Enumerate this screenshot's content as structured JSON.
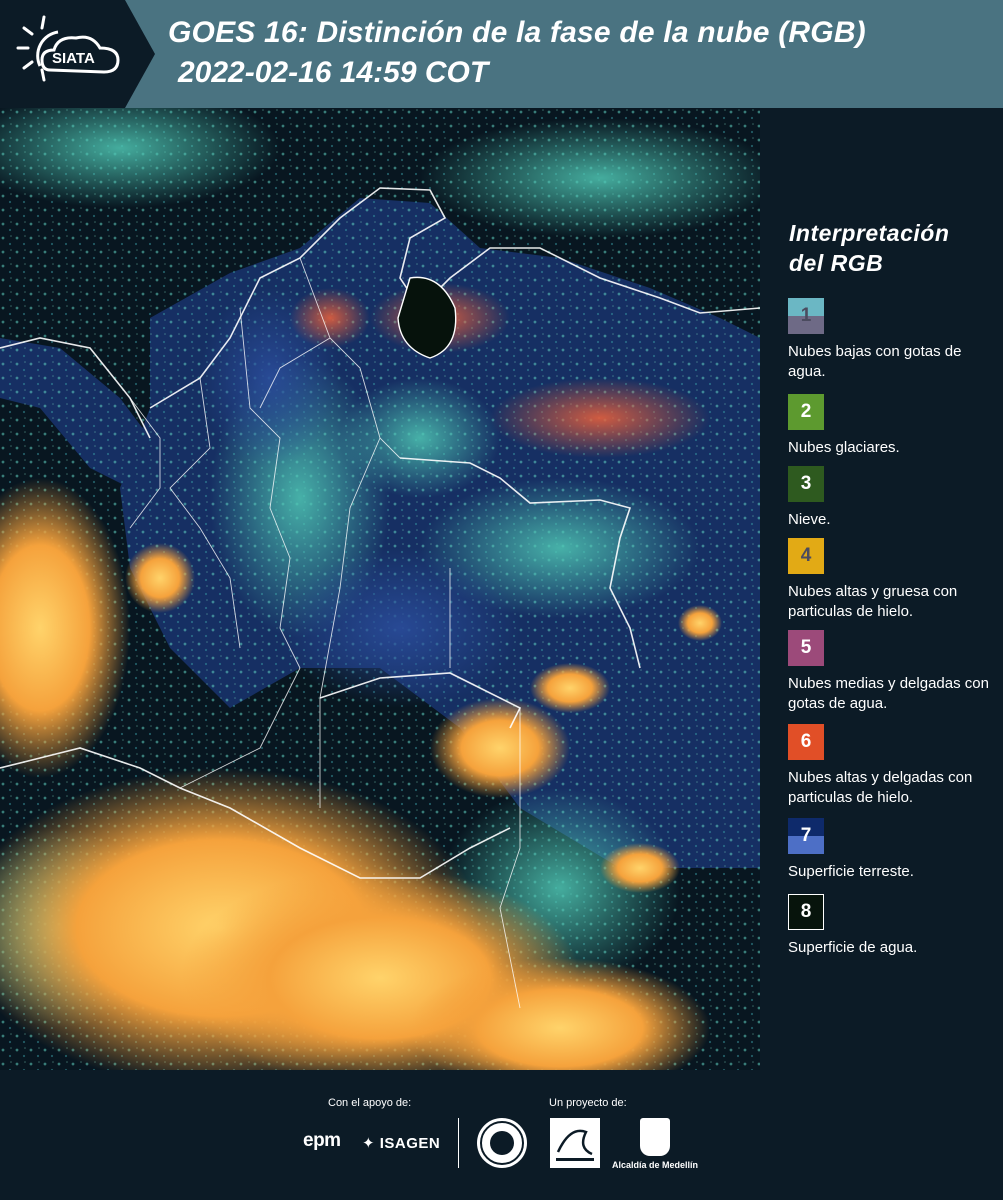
{
  "header": {
    "logo_text": "SIATA",
    "title_line1": "GOES 16: Distinción de la fase de la nube (RGB)",
    "title_line2": "2022-02-16 14:59 COT"
  },
  "legend": {
    "title_line1": "Interpretación",
    "title_line2": "del RGB",
    "items": [
      {
        "num": "1",
        "label": "Nubes bajas con gotas de agua.",
        "color_top": "#6bb7c4",
        "color_bottom": "#6e6a86",
        "num_color": "#4b4b5f"
      },
      {
        "num": "2",
        "label": "Nubes glaciares.",
        "color_top": "#5d9a2f",
        "color_bottom": "#5d9a2f",
        "num_color": "#ffffff"
      },
      {
        "num": "3",
        "label": "Nieve.",
        "color_top": "#2e5a1f",
        "color_bottom": "#2e5a1f",
        "num_color": "#ffffff"
      },
      {
        "num": "4",
        "label": "Nubes altas y gruesa con particulas de hielo.",
        "color_top": "#e2aa15",
        "color_bottom": "#e2aa15",
        "num_color": "#4b4b5f"
      },
      {
        "num": "5",
        "label": "Nubes medias y delgadas con gotas de agua.",
        "color_top": "#9c4a7a",
        "color_bottom": "#9c4a7a",
        "num_color": "#ffffff"
      },
      {
        "num": "6",
        "label": "Nubes altas y delgadas con particulas de hielo.",
        "color_top": "#e14f27",
        "color_bottom": "#e14f27",
        "num_color": "#ffffff"
      },
      {
        "num": "7",
        "label": "Superficie terreste.",
        "color_top": "#0e2a6b",
        "color_bottom": "#4d6fc6",
        "num_color": "#ffffff"
      },
      {
        "num": "8",
        "label": "Superficie de agua.",
        "color_top": "#07140c",
        "color_bottom": "#07140c",
        "num_color": "#ffffff"
      }
    ]
  },
  "footer": {
    "support_label": "Con el apoyo de:",
    "project_label": "Un proyecto de:",
    "sponsor1": "epm",
    "sponsor2": "ISAGEN",
    "partner3": "Alcaldía de Medellín"
  }
}
